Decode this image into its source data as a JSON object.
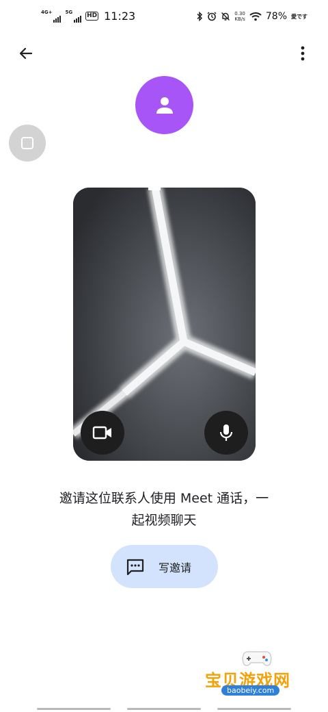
{
  "status_bar": {
    "network_1": "4G+",
    "network_2": "5G",
    "hd_badge": "HD",
    "time": "11:23",
    "speed_value": "0.30",
    "speed_unit": "KB/s",
    "battery": "78%",
    "carrier_tag": "愛です"
  },
  "toolbar": {
    "back_icon": "arrow-left-icon",
    "more_icon": "more-vert-icon"
  },
  "contact": {
    "avatar_icon": "person-icon",
    "avatar_color": "#a855f7"
  },
  "preview": {
    "camera_icon": "videocam-icon",
    "mic_icon": "mic-icon"
  },
  "invite": {
    "line1": "邀请这位联系人使用 Meet 通话，一",
    "line2": "起视频聊天"
  },
  "write_invite": {
    "label": "写邀请",
    "icon": "message-icon",
    "bg_color": "#d3e3fd"
  },
  "watermark": {
    "text": "宝贝游戏网",
    "url": "baobeiy.com"
  }
}
